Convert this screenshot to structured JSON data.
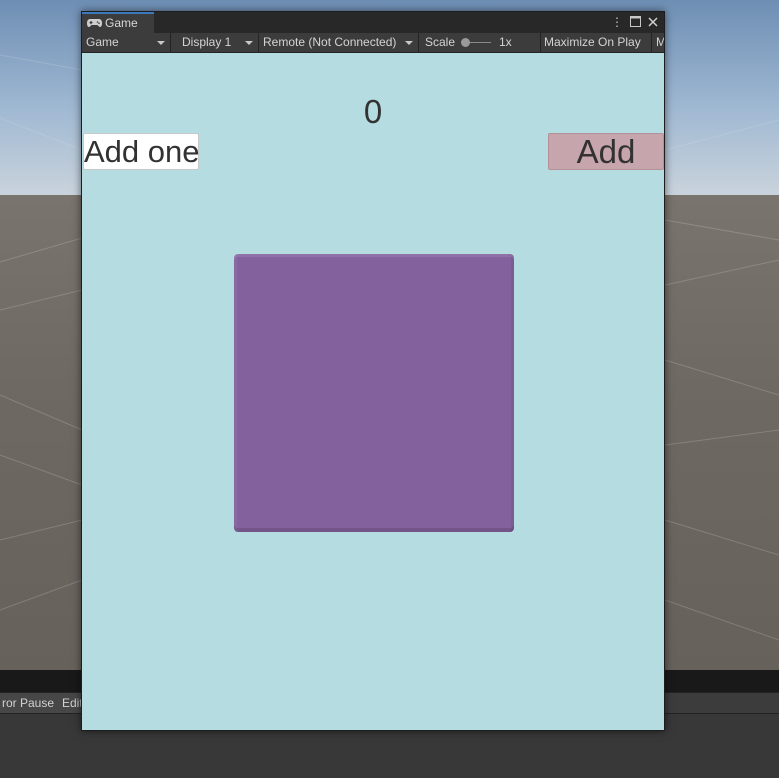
{
  "game_window": {
    "tab_label": "Game",
    "tab_icon": "gamepad-icon",
    "window_icons": [
      "more-options-icon",
      "maximize-icon",
      "close-icon"
    ],
    "toolbar": {
      "view_mode": "Game",
      "display": "Display 1",
      "remote": "Remote (Not Connected)",
      "scale_label": "Scale",
      "scale_value": "1x",
      "maximize_on_play": "Maximize On Play",
      "overflow_item": "M"
    }
  },
  "game_view": {
    "counter_value": "0",
    "add_one_button": "Add one",
    "add_button": "Add",
    "background_color": "#b4dce1",
    "box_color": "#83619d"
  },
  "bottom_toolbar": {
    "error_pause": "ror Pause",
    "editor": "Editi"
  }
}
